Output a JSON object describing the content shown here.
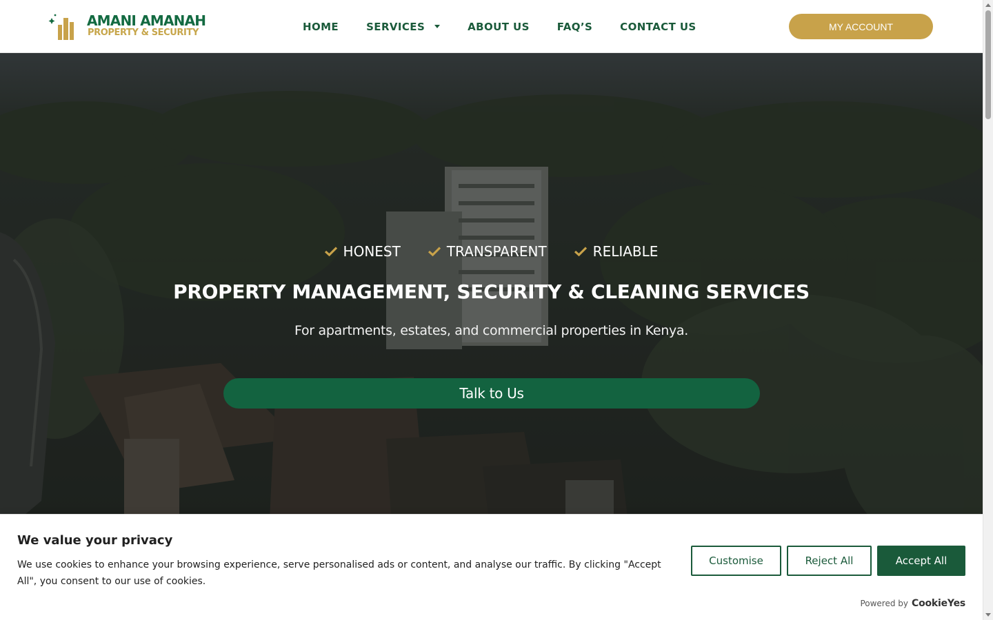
{
  "header": {
    "logo": {
      "name": "AMANI AMANAH",
      "tagline": "PROPERTY & SECURITY",
      "icon": "building-crescent-logo"
    },
    "nav": [
      {
        "label": "HOME"
      },
      {
        "label": "SERVICES",
        "has_dropdown": true
      },
      {
        "label": "ABOUT US"
      },
      {
        "label": "FAQ’S"
      },
      {
        "label": "CONTACT US"
      }
    ],
    "account_button": "MY ACCOUNT"
  },
  "hero": {
    "values": [
      "HONEST",
      "TRANSPARENT",
      "RELIABLE"
    ],
    "title": "PROPERTY MANAGEMENT, SECURITY & CLEANING SERVICES",
    "subtitle": "For apartments, estates, and commercial properties in Kenya.",
    "cta": "Talk to Us"
  },
  "cookie_banner": {
    "title": "We value your privacy",
    "text": "We use cookies to enhance your browsing experience, serve personalised ads or content, and analyse our traffic. By clicking \"Accept All\", you consent to our use of cookies.",
    "buttons": {
      "customise": "Customise",
      "reject": "Reject All",
      "accept": "Accept All"
    },
    "powered_by": "Powered by",
    "brand": "CookieYes"
  },
  "colors": {
    "brand_green": "#136a41",
    "brand_gold": "#c8a24a",
    "nav_text": "#1a5a3a",
    "cta_green": "#136340"
  }
}
